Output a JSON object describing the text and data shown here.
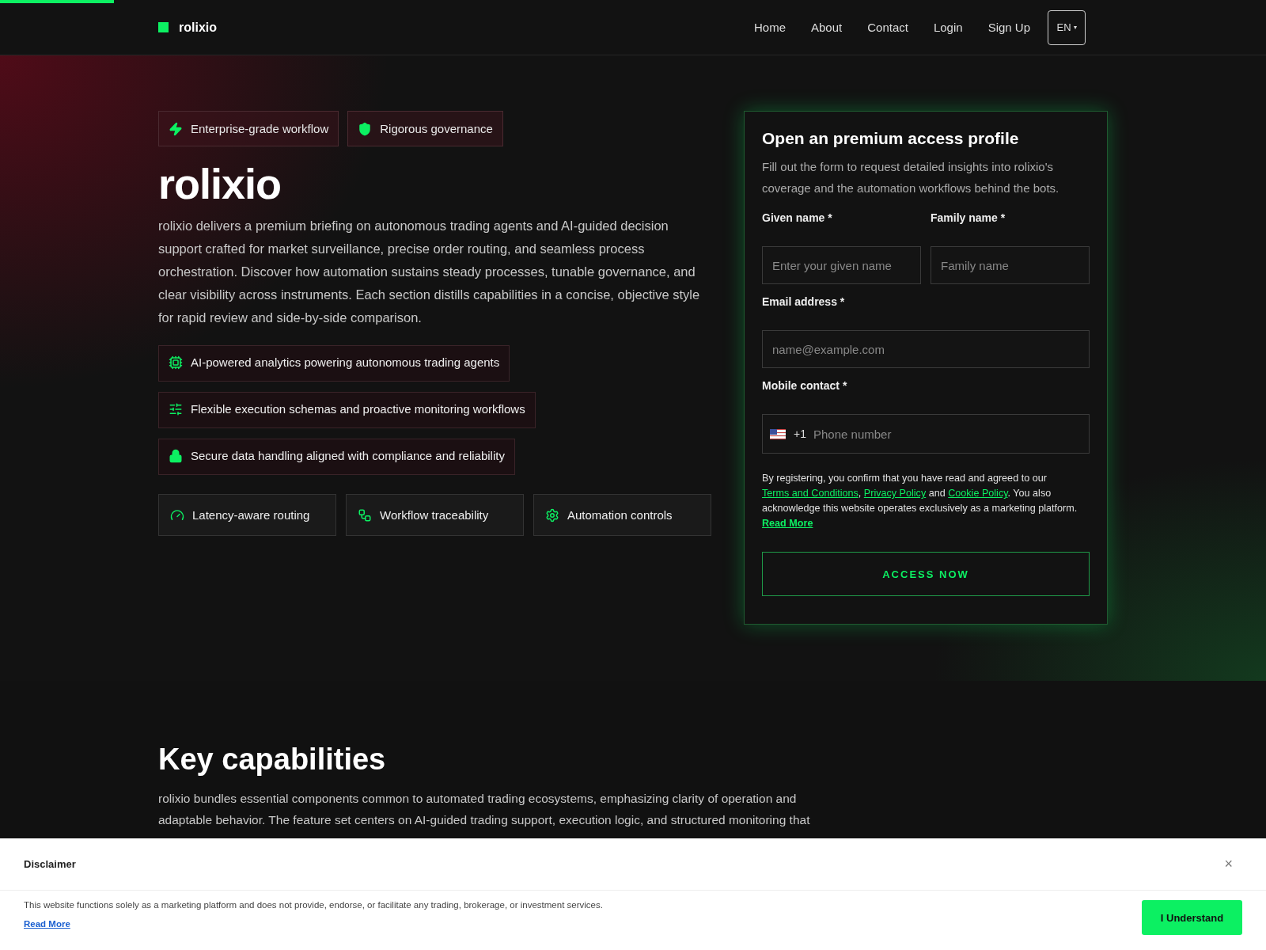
{
  "nav": {
    "brand": "rolixio",
    "links": [
      {
        "label": "Home"
      },
      {
        "label": "About"
      },
      {
        "label": "Contact"
      },
      {
        "label": "Login"
      },
      {
        "label": "Sign Up"
      }
    ],
    "language": {
      "label": "EN",
      "caret": "▾"
    }
  },
  "hero": {
    "badges": [
      {
        "kind": "bolt",
        "label": "Enterprise-grade workflow"
      },
      {
        "kind": "shield",
        "label": "Rigorous governance"
      }
    ],
    "title": "rolixio",
    "intro": "rolixio delivers a premium briefing on autonomous trading agents and AI-guided decision support crafted for market surveillance, precise order routing, and seamless process orchestration. Discover how automation sustains steady processes, tunable governance, and clear visibility across instruments. Each section distills capabilities in a concise, objective style for rapid review and side-by-side comparison.",
    "highlights": [
      {
        "kind": "chip",
        "label": "AI-powered analytics powering autonomous trading agents"
      },
      {
        "kind": "sliders",
        "label": "Flexible execution schemas and proactive monitoring workflows"
      },
      {
        "kind": "lock",
        "label": "Secure data handling aligned with compliance and reliability"
      }
    ],
    "features": [
      {
        "kind": "gauge",
        "label": "Latency-aware routing"
      },
      {
        "kind": "flow",
        "label": "Workflow traceability"
      },
      {
        "kind": "gear",
        "label": "Automation controls"
      }
    ]
  },
  "form": {
    "title": "Open an premium access profile",
    "subtitle": "Fill out the form to request detailed insights into rolixio's coverage and the automation workflows behind the bots.",
    "given_name": {
      "label": "Given name *",
      "placeholder": "Enter your given name"
    },
    "family_name": {
      "label": "Family name *",
      "placeholder": "Family name"
    },
    "email": {
      "label": "Email address *",
      "placeholder": "name@example.com"
    },
    "phone": {
      "label": "Mobile contact *",
      "dial_code": "+1",
      "placeholder": "Phone number"
    },
    "consent": {
      "before": "By registering, you confirm that you have read and agreed to our",
      "terms": "Terms and Conditions",
      "comma": ",",
      "privacy": "Privacy Policy",
      "and": "and",
      "cookie": "Cookie Policy",
      "after": ". You also acknowledge this website operates exclusively as a marketing platform.",
      "read_more": "Read More"
    },
    "submit": "ACCESS NOW"
  },
  "capabilities": {
    "title": "Key capabilities",
    "text": "rolixio bundles essential components common to automated trading ecosystems, emphasizing clarity of operation and adaptable behavior. The feature set centers on AI-guided trading support, execution logic, and structured monitoring that"
  },
  "disclaimer": {
    "title": "Disclaimer",
    "close": "×",
    "text": "This website functions solely as a marketing platform and does not provide, endorse, or facilitate any trading, brokerage, or investment services.",
    "read_more": "Read More",
    "button": "I Understand"
  }
}
